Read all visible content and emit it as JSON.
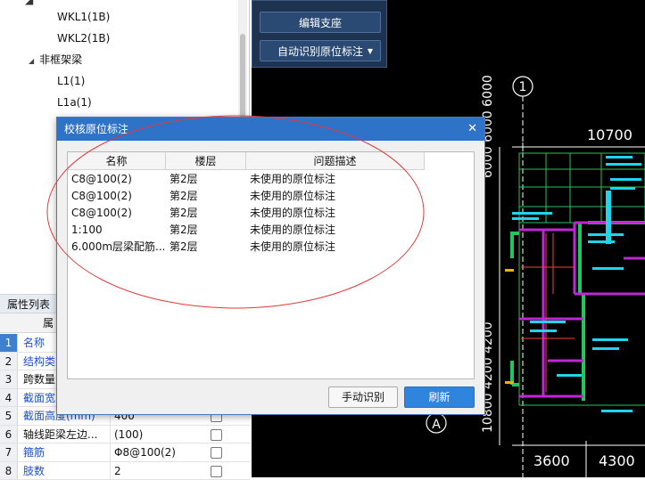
{
  "tree": {
    "items": [
      {
        "label": "WKL1(1B)",
        "indent": 2
      },
      {
        "label": "WKL2(1B)",
        "indent": 2
      },
      {
        "label": "非框架梁",
        "indent": 1,
        "toggle": "◢"
      },
      {
        "label": "L1(1)",
        "indent": 2
      },
      {
        "label": "L1a(1)",
        "indent": 2
      }
    ]
  },
  "toolbar": {
    "edit_support_label": "编辑支座",
    "auto_identify_label": "自动识别原位标注"
  },
  "properties": {
    "title": "属性列表",
    "header_partial": "属",
    "rows": [
      {
        "idx": "1",
        "name": "名称",
        "value": "",
        "blue": true,
        "selected": true,
        "checkbox": false
      },
      {
        "idx": "2",
        "name": "结构类",
        "value": "",
        "blue": true,
        "checkbox": false
      },
      {
        "idx": "3",
        "name": "跨数量",
        "value": "",
        "blue": false,
        "checkbox": false
      },
      {
        "idx": "4",
        "name": "截面宽",
        "value": "",
        "blue": true,
        "checkbox": false
      },
      {
        "idx": "5",
        "name": "截面高度(mm)",
        "value": "400",
        "blue": true,
        "checkbox": true
      },
      {
        "idx": "6",
        "name": "轴线距梁左边...",
        "value": "(100)",
        "blue": false,
        "checkbox": true
      },
      {
        "idx": "7",
        "name": "箍筋",
        "value": "Φ8@100(2)",
        "blue": true,
        "checkbox": true
      },
      {
        "idx": "8",
        "name": "肢数",
        "value": "2",
        "blue": true,
        "checkbox": true
      }
    ]
  },
  "cad": {
    "axis_top": "1",
    "axis_bottom": "A",
    "dim_top": "10700",
    "dim_bottom_1": "3600",
    "dim_bottom_2": "4300",
    "dim_left_top": "6000 6000 6000",
    "dim_left_bottom": "10800 4200 4200",
    "line_color": "#22c55e",
    "beam_color": "#c026d3"
  },
  "dialog": {
    "title": "校核原位标注",
    "columns": [
      "名称",
      "楼层",
      "问题描述"
    ],
    "rows": [
      {
        "name": "C8@100(2)",
        "floor": "第2层",
        "desc": "未使用的原位标注"
      },
      {
        "name": "C8@100(2)",
        "floor": "第2层",
        "desc": "未使用的原位标注"
      },
      {
        "name": "C8@100(2)",
        "floor": "第2层",
        "desc": "未使用的原位标注"
      },
      {
        "name": "1:100",
        "floor": "第2层",
        "desc": "未使用的原位标注"
      },
      {
        "name": "6.000m层梁配筋...",
        "floor": "第2层",
        "desc": "未使用的原位标注"
      }
    ],
    "manual_button": "手动识别",
    "refresh_button": "刷新"
  },
  "colors": {
    "dialog_title_bg": "#2f73c9",
    "primary_button": "#2f84de",
    "annotation_ellipse": "#e23a3a"
  }
}
